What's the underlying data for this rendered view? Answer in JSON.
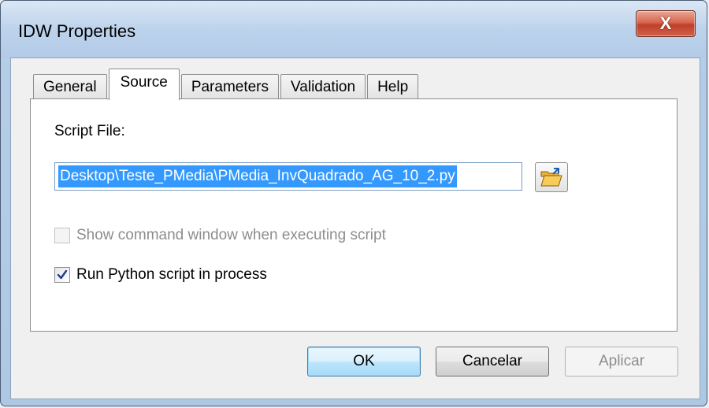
{
  "window": {
    "title": "IDW Properties",
    "close_symbol": "X"
  },
  "tabs": [
    {
      "label": "General",
      "active": false
    },
    {
      "label": "Source",
      "active": true
    },
    {
      "label": "Parameters",
      "active": false
    },
    {
      "label": "Validation",
      "active": false
    },
    {
      "label": "Help",
      "active": false
    }
  ],
  "source": {
    "script_file_label": "Script File:",
    "script_file_value": "Desktop\\Teste_PMedia\\PMedia_InvQuadrado_AG_10_2.py",
    "browse_icon": "folder-open-icon",
    "show_command_window": {
      "label": "Show command window when executing script",
      "checked": false,
      "enabled": false
    },
    "run_in_process": {
      "label": "Run Python script in process",
      "checked": true,
      "enabled": true
    }
  },
  "buttons": {
    "ok": "OK",
    "cancel": "Cancelar",
    "apply": "Aplicar"
  },
  "colors": {
    "selection": "#3399ff",
    "close_button": "#c7452f",
    "titlebar": "#bdd3ec"
  }
}
